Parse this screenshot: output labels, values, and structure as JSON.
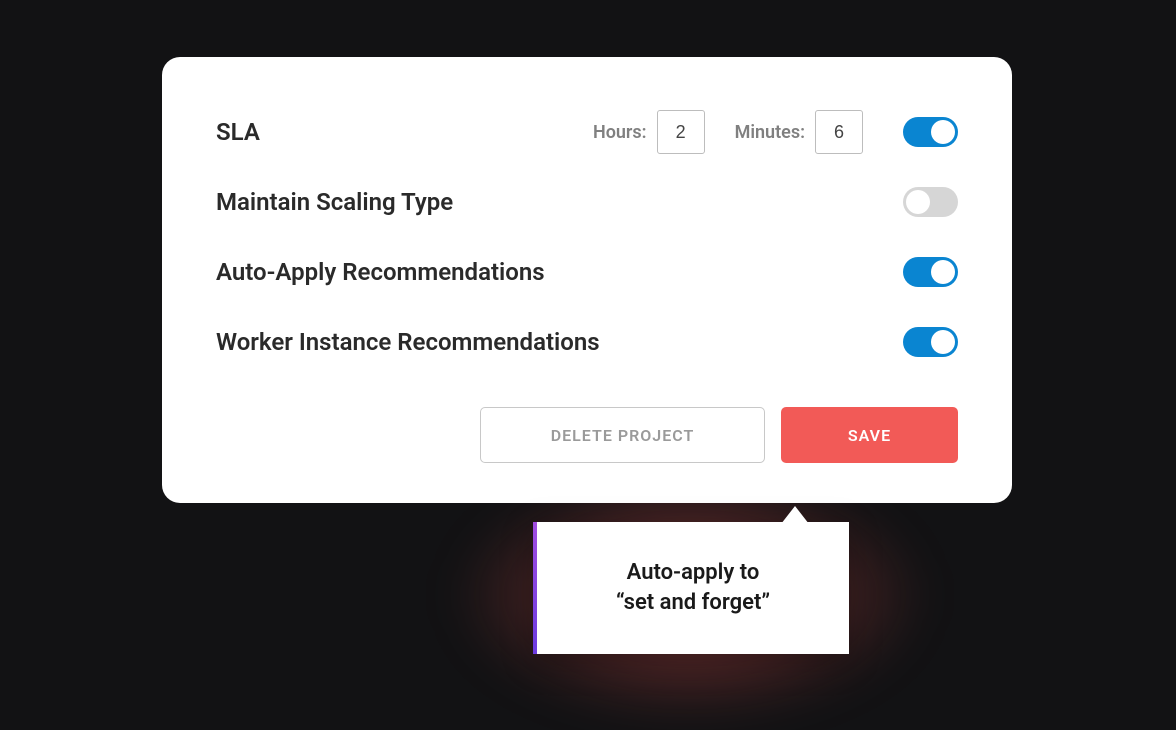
{
  "rows": {
    "sla": {
      "label": "SLA",
      "hours_label": "Hours:",
      "hours_value": "2",
      "minutes_label": "Minutes:",
      "minutes_value": "6",
      "toggle_on": true
    },
    "maintain": {
      "label": "Maintain Scaling Type",
      "toggle_on": false
    },
    "autoapply": {
      "label": "Auto-Apply Recommendations",
      "toggle_on": true
    },
    "worker": {
      "label": "Worker Instance Recommendations",
      "toggle_on": true
    }
  },
  "buttons": {
    "delete": "DELETE PROJECT",
    "save": "SAVE"
  },
  "tooltip": {
    "text": "Auto-apply to\n“set and forget”"
  }
}
